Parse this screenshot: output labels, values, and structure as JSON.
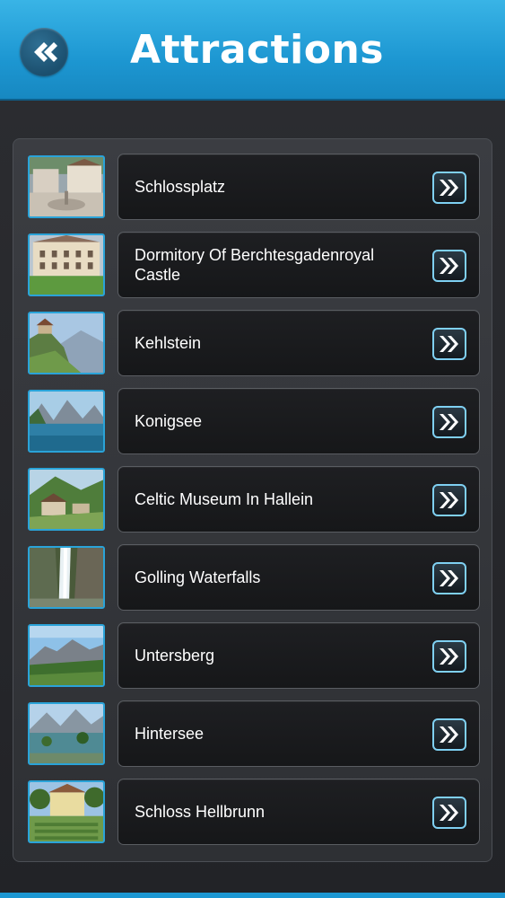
{
  "header": {
    "title": "Attractions",
    "back_icon": "double-chevron-left-icon",
    "accent_color": "#1d97d2"
  },
  "list": {
    "items": [
      {
        "label": "Schlossplatz",
        "thumb": "town-square"
      },
      {
        "label": "Dormitory Of Berchtesgadenroyal Castle",
        "thumb": "castle-building"
      },
      {
        "label": "Kehlstein",
        "thumb": "mountain-house"
      },
      {
        "label": "Konigsee",
        "thumb": "lake-mountains"
      },
      {
        "label": "Celtic Museum In Hallein",
        "thumb": "village-hills"
      },
      {
        "label": "Golling Waterfalls",
        "thumb": "waterfall"
      },
      {
        "label": "Untersberg",
        "thumb": "mountain-meadow"
      },
      {
        "label": "Hintersee",
        "thumb": "alpine-lake"
      },
      {
        "label": "Schloss Hellbrunn",
        "thumb": "palace-garden"
      }
    ],
    "row_action_icon": "double-chevron-right-icon"
  }
}
